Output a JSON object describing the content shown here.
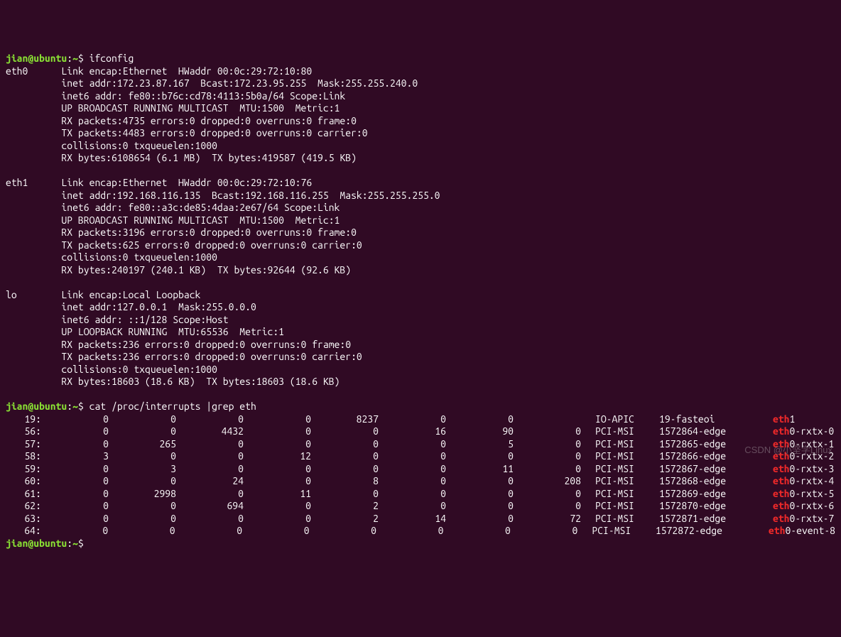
{
  "prompt": {
    "user": "jian@ubuntu",
    "path": "~",
    "sep1": ":",
    "sep2": "$"
  },
  "cmd1": "ifconfig",
  "ifc": {
    "eth0": [
      "eth0      Link encap:Ethernet  HWaddr 00:0c:29:72:10:80",
      "          inet addr:172.23.87.167  Bcast:172.23.95.255  Mask:255.255.240.0",
      "          inet6 addr: fe80::b76c:cd78:4113:5b0a/64 Scope:Link",
      "          UP BROADCAST RUNNING MULTICAST  MTU:1500  Metric:1",
      "          RX packets:4735 errors:0 dropped:0 overruns:0 frame:0",
      "          TX packets:4483 errors:0 dropped:0 overruns:0 carrier:0",
      "          collisions:0 txqueuelen:1000",
      "          RX bytes:6108654 (6.1 MB)  TX bytes:419587 (419.5 KB)"
    ],
    "eth1": [
      "eth1      Link encap:Ethernet  HWaddr 00:0c:29:72:10:76",
      "          inet addr:192.168.116.135  Bcast:192.168.116.255  Mask:255.255.255.0",
      "          inet6 addr: fe80::a3c:de85:4daa:2e67/64 Scope:Link",
      "          UP BROADCAST RUNNING MULTICAST  MTU:1500  Metric:1",
      "          RX packets:3196 errors:0 dropped:0 overruns:0 frame:0",
      "          TX packets:625 errors:0 dropped:0 overruns:0 carrier:0",
      "          collisions:0 txqueuelen:1000",
      "          RX bytes:240197 (240.1 KB)  TX bytes:92644 (92.6 KB)"
    ],
    "lo": [
      "lo        Link encap:Local Loopback",
      "          inet addr:127.0.0.1  Mask:255.0.0.0",
      "          inet6 addr: ::1/128 Scope:Host",
      "          UP LOOPBACK RUNNING  MTU:65536  Metric:1",
      "          RX packets:236 errors:0 dropped:0 overruns:0 frame:0",
      "          TX packets:236 errors:0 dropped:0 overruns:0 carrier:0",
      "          collisions:0 txqueuelen:1000",
      "          RX bytes:18603 (18.6 KB)  TX bytes:18603 (18.6 KB)"
    ]
  },
  "cmd2": "cat /proc/interrupts |grep eth",
  "int_rows": [
    {
      "irq": "19:",
      "v": [
        "0",
        "0",
        "0",
        "0",
        "8237",
        "0",
        "0"
      ],
      "type": "IO-APIC",
      "edge": "19-fasteoi",
      "hl": "eth",
      "rest": "1"
    },
    {
      "irq": "56:",
      "v": [
        "0",
        "0",
        "4432",
        "0",
        "0",
        "16",
        "90",
        "0"
      ],
      "type": "PCI-MSI",
      "edge": "1572864-edge",
      "hl": "eth",
      "rest": "0-rxtx-0"
    },
    {
      "irq": "57:",
      "v": [
        "0",
        "265",
        "0",
        "0",
        "0",
        "0",
        "5",
        "0"
      ],
      "type": "PCI-MSI",
      "edge": "1572865-edge",
      "hl": "eth",
      "rest": "0-rxtx-1"
    },
    {
      "irq": "58:",
      "v": [
        "3",
        "0",
        "0",
        "12",
        "0",
        "0",
        "0",
        "0"
      ],
      "type": "PCI-MSI",
      "edge": "1572866-edge",
      "hl": "eth",
      "rest": "0-rxtx-2"
    },
    {
      "irq": "59:",
      "v": [
        "0",
        "3",
        "0",
        "0",
        "0",
        "0",
        "11",
        "0"
      ],
      "type": "PCI-MSI",
      "edge": "1572867-edge",
      "hl": "eth",
      "rest": "0-rxtx-3"
    },
    {
      "irq": "60:",
      "v": [
        "0",
        "0",
        "24",
        "0",
        "8",
        "0",
        "0",
        "208"
      ],
      "type": "PCI-MSI",
      "edge": "1572868-edge",
      "hl": "eth",
      "rest": "0-rxtx-4"
    },
    {
      "irq": "61:",
      "v": [
        "0",
        "2998",
        "0",
        "11",
        "0",
        "0",
        "0",
        "0"
      ],
      "type": "PCI-MSI",
      "edge": "1572869-edge",
      "hl": "eth",
      "rest": "0-rxtx-5"
    },
    {
      "irq": "62:",
      "v": [
        "0",
        "0",
        "694",
        "0",
        "2",
        "0",
        "0",
        "0"
      ],
      "type": "PCI-MSI",
      "edge": "1572870-edge",
      "hl": "eth",
      "rest": "0-rxtx-6"
    },
    {
      "irq": "63:",
      "v": [
        "0",
        "0",
        "0",
        "0",
        "2",
        "14",
        "0",
        "72"
      ],
      "type": "PCI-MSI",
      "edge": "1572871-edge",
      "hl": "eth",
      "rest": "0-rxtx-7"
    },
    {
      "irq": "64:",
      "v": [
        "0",
        "0",
        "0",
        "0",
        "0",
        "0",
        "0",
        "0"
      ],
      "type": "PCI-MSI",
      "edge": "1572872-edge",
      "hl": "eth",
      "rest": "0-event-8"
    }
  ],
  "watermark": "CSDN @小坚学Linux"
}
